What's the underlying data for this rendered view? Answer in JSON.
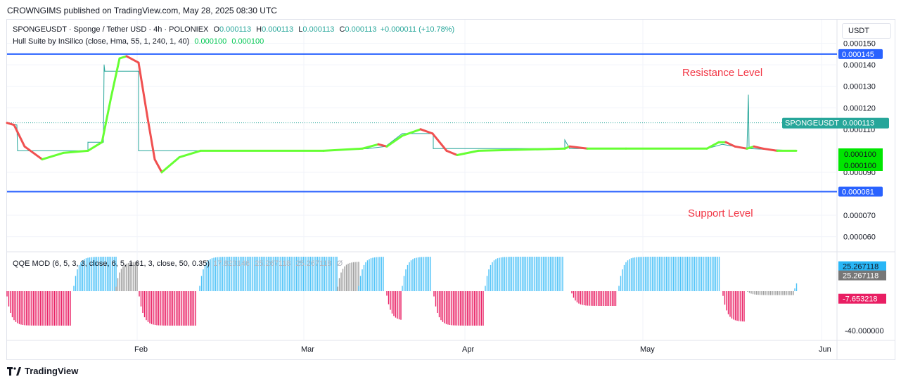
{
  "header": {
    "published": "CROWNGIMS published on TradingView.com, May 28, 2025 08:30 UTC"
  },
  "symbol_legend": {
    "title": "SPONGEUSDT · Sponge / Tether USD · 4h · POLONIEX",
    "o_label": "O",
    "o": "0.000113",
    "h_label": "H",
    "h": "0.000113",
    "l_label": "L",
    "l": "0.000113",
    "c_label": "C",
    "c": "0.000113",
    "change": "+0.000011 (+10.78%)"
  },
  "hull_legend": {
    "label": "Hull Suite by InSilico (close, Hma, 55, 1, 240, 1, 40)",
    "v1": "0.000100",
    "v2": "0.000100"
  },
  "qqe_legend": {
    "label": "QQE MOD (6, 5, 3, 3, close, 6, 5, 1.61, 3, close, 50, 0.35)",
    "v1": "17.823146",
    "v2": "25.267118",
    "v3": "25.267118",
    "v4": "Ø"
  },
  "currency": "USDT",
  "annotations": {
    "resistance": "Resistance Level",
    "support": "Support Level"
  },
  "footer": {
    "brand": "TradingView"
  },
  "colors": {
    "up": "#26a69a",
    "hull_up": "#66ff33",
    "hull_down": "#f05050",
    "level": "#2962ff",
    "qqe_blue": "#4fc3f7",
    "qqe_gray": "#9e9e9e",
    "qqe_pink": "#e91e63"
  },
  "chart_data": [
    {
      "type": "line",
      "title": "SPONGEUSDT · Sponge / Tether USD · 4h · POLONIEX",
      "x_ticks": [
        "Feb",
        "Mar",
        "Apr",
        "May",
        "Jun"
      ],
      "y_ticks": [
        "0.000150",
        "0.000140",
        "0.000130",
        "0.000120",
        "0.000110",
        "0.000090",
        "0.000070",
        "0.000060"
      ],
      "ylim": [
        5.3e-05,
        0.000161
      ],
      "grid": true,
      "series": [
        {
          "name": "SPONGEUSDT",
          "points": [
            [
              0,
              0.000113
            ],
            [
              14,
              0.000112
            ],
            [
              15,
              0.0001
            ],
            [
              115,
              0.0001
            ],
            [
              115,
              0.000104
            ],
            [
              137,
              0.000104
            ],
            [
              138,
              0.00014
            ],
            [
              139,
              0.000137
            ],
            [
              187,
              0.000137
            ],
            [
              187,
              0.0001
            ],
            [
              450,
              0.0001
            ],
            [
              513,
              0.000101
            ],
            [
              538,
              0.000102
            ],
            [
              562,
              0.000108
            ],
            [
              606,
              0.000108
            ],
            [
              606,
              0.000101
            ],
            [
              793,
              0.000101
            ],
            [
              793,
              0.000105
            ],
            [
              800,
              0.000101
            ],
            [
              995,
              0.000101
            ],
            [
              1017,
              0.000103
            ],
            [
              1052,
              0.000101
            ],
            [
              1054,
              0.000126
            ],
            [
              1055,
              0.000101
            ],
            [
              1122,
              0.0001
            ]
          ]
        },
        {
          "name": "Hull Suite",
          "points": [
            [
              0,
              0.000113
            ],
            [
              10,
              0.000112
            ],
            [
              25,
              0.000102
            ],
            [
              50,
              9.6e-05
            ],
            [
              80,
              9.9e-05
            ],
            [
              115,
              0.0001
            ],
            [
              135,
              0.000104
            ],
            [
              148,
              0.000125
            ],
            [
              160,
              0.000143
            ],
            [
              170,
              0.000144
            ],
            [
              187,
              0.000141
            ],
            [
              200,
              0.000115
            ],
            [
              210,
              9.6e-05
            ],
            [
              220,
              9e-05
            ],
            [
              245,
              9.7e-05
            ],
            [
              275,
              0.0001
            ],
            [
              450,
              0.0001
            ],
            [
              505,
              0.000101
            ],
            [
              528,
              0.000103
            ],
            [
              540,
              0.000102
            ],
            [
              562,
              0.000107
            ],
            [
              588,
              0.00011
            ],
            [
              605,
              0.000108
            ],
            [
              625,
              0.0001
            ],
            [
              640,
              9.8e-05
            ],
            [
              670,
              0.0001
            ],
            [
              793,
              0.000101
            ],
            [
              800,
              0.000102
            ],
            [
              825,
              0.000101
            ],
            [
              880,
              0.000101
            ],
            [
              995,
              0.000101
            ],
            [
              1012,
              0.000104
            ],
            [
              1022,
              0.000104
            ],
            [
              1035,
              0.000102
            ],
            [
              1052,
              0.000101
            ],
            [
              1062,
              0.000102
            ],
            [
              1075,
              0.000101
            ],
            [
              1095,
              0.0001
            ],
            [
              1122,
              0.0001
            ]
          ]
        }
      ],
      "levels": [
        {
          "label": "Resistance Level",
          "value": 0.000145,
          "tag": "0.000145"
        },
        {
          "label": "Support Level",
          "value": 8.1e-05,
          "tag": "0.000081"
        }
      ],
      "last_price": {
        "label": "SPONGEUSDT",
        "value": 0.000113,
        "tag": "0.000113"
      },
      "hull_tags": [
        "0.000100",
        "0.000100"
      ]
    },
    {
      "type": "bar",
      "title": "QQE MOD (6, 5, 3, 3, close, 6, 5, 1.61, 3, close, 50, 0.35)",
      "y_ticks": [
        "17.823146",
        "-40.000000"
      ],
      "ylim": [
        -50,
        40
      ],
      "tags": [
        {
          "text": "25.267118",
          "kind": "blue",
          "value": 25.3
        },
        {
          "text": "25.267118",
          "kind": "gray",
          "value": 16
        },
        {
          "text": "-7.653218",
          "kind": "pink",
          "value": -7.65
        }
      ],
      "segments": [
        {
          "x0": 0,
          "x1": 92,
          "value": -35,
          "color": "pink"
        },
        {
          "x0": 95,
          "x1": 155,
          "value": 35,
          "color": "blue"
        },
        {
          "x0": 155,
          "x1": 185,
          "value": 30,
          "color": "gray"
        },
        {
          "x0": 188,
          "x1": 270,
          "value": -35,
          "color": "pink"
        },
        {
          "x0": 274,
          "x1": 470,
          "value": 35,
          "color": "blue"
        },
        {
          "x0": 470,
          "x1": 500,
          "value": 30,
          "color": "gray"
        },
        {
          "x0": 500,
          "x1": 537,
          "value": 35,
          "color": "blue"
        },
        {
          "x0": 540,
          "x1": 560,
          "value": -30,
          "color": "pink"
        },
        {
          "x0": 562,
          "x1": 604,
          "value": 35,
          "color": "blue"
        },
        {
          "x0": 607,
          "x1": 677,
          "value": -35,
          "color": "pink"
        },
        {
          "x0": 680,
          "x1": 790,
          "value": 35,
          "color": "blue"
        },
        {
          "x0": 803,
          "x1": 866,
          "value": -15,
          "color": "pink"
        },
        {
          "x0": 870,
          "x1": 1013,
          "value": 35,
          "color": "blue"
        },
        {
          "x0": 1018,
          "x1": 1050,
          "value": -31,
          "color": "pink"
        },
        {
          "x0": 1053,
          "x1": 1120,
          "value": -4,
          "color": "gray"
        },
        {
          "x0": 1120,
          "x1": 1123,
          "value": 18,
          "color": "blue"
        }
      ]
    }
  ]
}
